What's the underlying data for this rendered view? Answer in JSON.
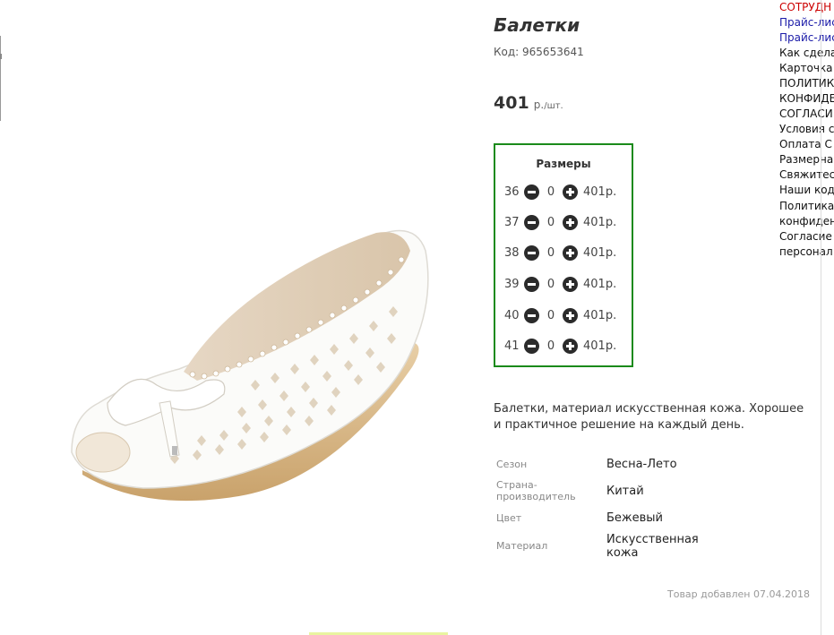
{
  "product": {
    "title": "Балетки",
    "code_label": "Код:",
    "code_value": "965653641",
    "price_value": "401",
    "price_unit": "р.",
    "price_per": "/шт."
  },
  "sizes": {
    "title": "Размеры",
    "rows": [
      {
        "size": "36",
        "qty": "0",
        "price": "401р."
      },
      {
        "size": "37",
        "qty": "0",
        "price": "401р."
      },
      {
        "size": "38",
        "qty": "0",
        "price": "401р."
      },
      {
        "size": "39",
        "qty": "0",
        "price": "401р."
      },
      {
        "size": "40",
        "qty": "0",
        "price": "401р."
      },
      {
        "size": "41",
        "qty": "0",
        "price": "401р."
      }
    ]
  },
  "description": "Балетки, материал искусственная кожа. Хорошее и практичное решение на каждый день.",
  "properties": [
    {
      "label": "Сезон",
      "value": "Весна-Лето"
    },
    {
      "label": "Страна-производитель",
      "value": "Китай"
    },
    {
      "label": "Цвет",
      "value": "Бежевый"
    },
    {
      "label": "Материал",
      "value": "Искусственная кожа"
    }
  ],
  "added": {
    "text": "Товар добавлен",
    "date": "07.04.2018"
  },
  "right_menu": [
    {
      "label": "СОТРУДН",
      "color": "#cc0000"
    },
    {
      "label": "Прайс-лис",
      "color": "#1a1aa8"
    },
    {
      "label": "Прайс-лис",
      "color": "#1a1aa8"
    },
    {
      "label": "Как сдела",
      "color": "#111111"
    },
    {
      "label": "Карточка",
      "color": "#111111"
    },
    {
      "label": "ПОЛИТИК",
      "color": "#111111"
    },
    {
      "label": "КОНФИДЕ",
      "color": "#111111"
    },
    {
      "label": "СОГЛАСИ",
      "color": "#111111"
    },
    {
      "label": "Условия с",
      "color": "#111111"
    },
    {
      "label": "Оплата С",
      "color": "#111111"
    },
    {
      "label": "Размерна",
      "color": "#111111"
    },
    {
      "label": "Свяжитес",
      "color": "#111111"
    },
    {
      "label": "Наши код",
      "color": "#111111"
    },
    {
      "label": "Политика",
      "color": "#111111"
    },
    {
      "label": "конфиден",
      "color": "#111111"
    },
    {
      "label": "Согласие",
      "color": "#111111"
    },
    {
      "label": "персонал",
      "color": "#111111"
    }
  ],
  "icons": {
    "minus": "minus-circle-icon",
    "plus": "plus-circle-icon"
  },
  "colors": {
    "sizes_border": "#1a8a1a"
  }
}
